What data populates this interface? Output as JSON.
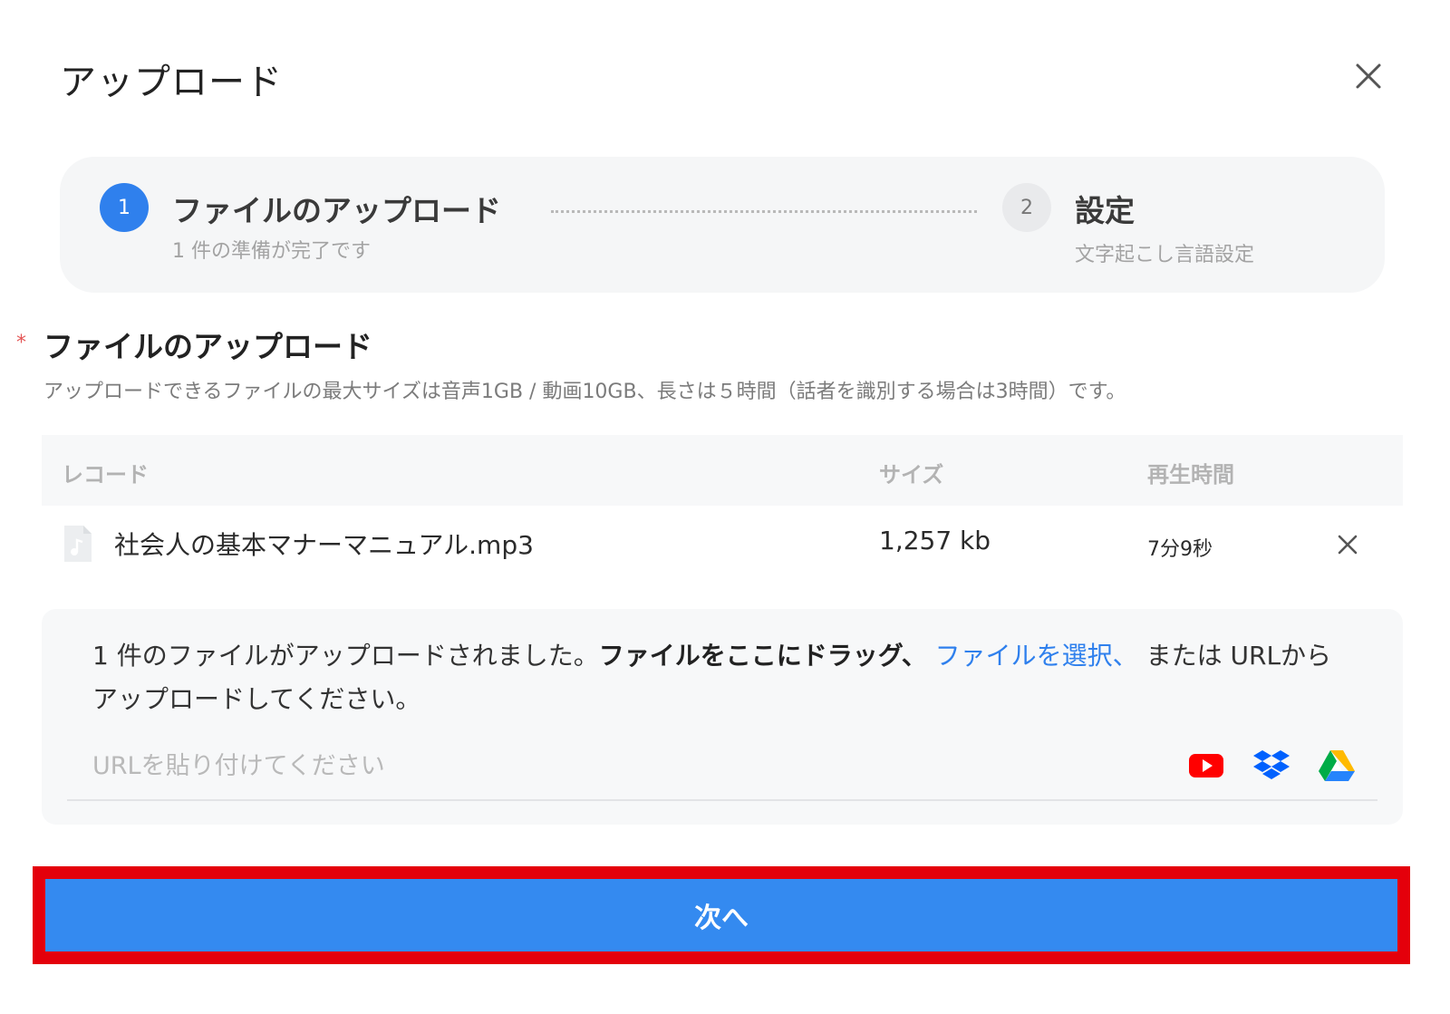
{
  "dialog": {
    "title": "アップロード"
  },
  "steps": [
    {
      "number": "1",
      "title": "ファイルのアップロード",
      "subtitle": "1 件の準備が完了です"
    },
    {
      "number": "2",
      "title": "設定",
      "subtitle": "文字起こし言語設定"
    }
  ],
  "section": {
    "required_mark": "*",
    "title": "ファイルのアップロード",
    "description": "アップロードできるファイルの最大サイズは音声1GB / 動画10GB、長さは５時間（話者を識別する場合は3時間）です。"
  },
  "table": {
    "columns": [
      "レコード",
      "サイズ",
      "再生時間"
    ],
    "rows": [
      {
        "name": "社会人の基本マナーマニュアル.mp3",
        "size": "1,257 kb",
        "duration": "7分9秒"
      }
    ]
  },
  "dropzone": {
    "text_prefix": "1 件のファイルがアップロードされました。",
    "text_bold": "ファイルをここにドラッグ、",
    "text_link": "ファイルを選択、",
    "text_suffix": "または URLからアップロードしてください。",
    "url_placeholder": "URLを貼り付けてください",
    "services": [
      "youtube-icon",
      "dropbox-icon",
      "google-drive-icon"
    ]
  },
  "footer": {
    "next_label": "次へ"
  },
  "colors": {
    "accent": "#348af0",
    "highlight": "#e4000b",
    "step_active": "#2f80ed"
  }
}
